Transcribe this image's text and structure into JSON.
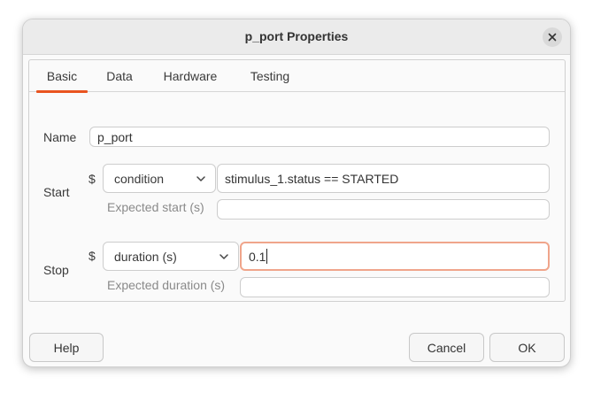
{
  "window": {
    "title": "p_port Properties",
    "close_icon": "close-icon"
  },
  "tabs": [
    {
      "label": "Basic",
      "active": true
    },
    {
      "label": "Data",
      "active": false
    },
    {
      "label": "Hardware",
      "active": false
    },
    {
      "label": "Testing",
      "active": false
    }
  ],
  "accent_color": "#e95420",
  "basic": {
    "name_label": "Name",
    "name_value": "p_port",
    "start": {
      "label": "Start",
      "dollar": "$",
      "type_selected": "condition",
      "value": "stimulus_1.status == STARTED",
      "expected_label": "Expected start (s)",
      "expected_value": ""
    },
    "stop": {
      "label": "Stop",
      "dollar": "$",
      "type_selected": "duration (s)",
      "value": "0.1",
      "expected_label": "Expected duration (s)",
      "expected_value": ""
    }
  },
  "buttons": {
    "help": "Help",
    "cancel": "Cancel",
    "ok": "OK"
  }
}
